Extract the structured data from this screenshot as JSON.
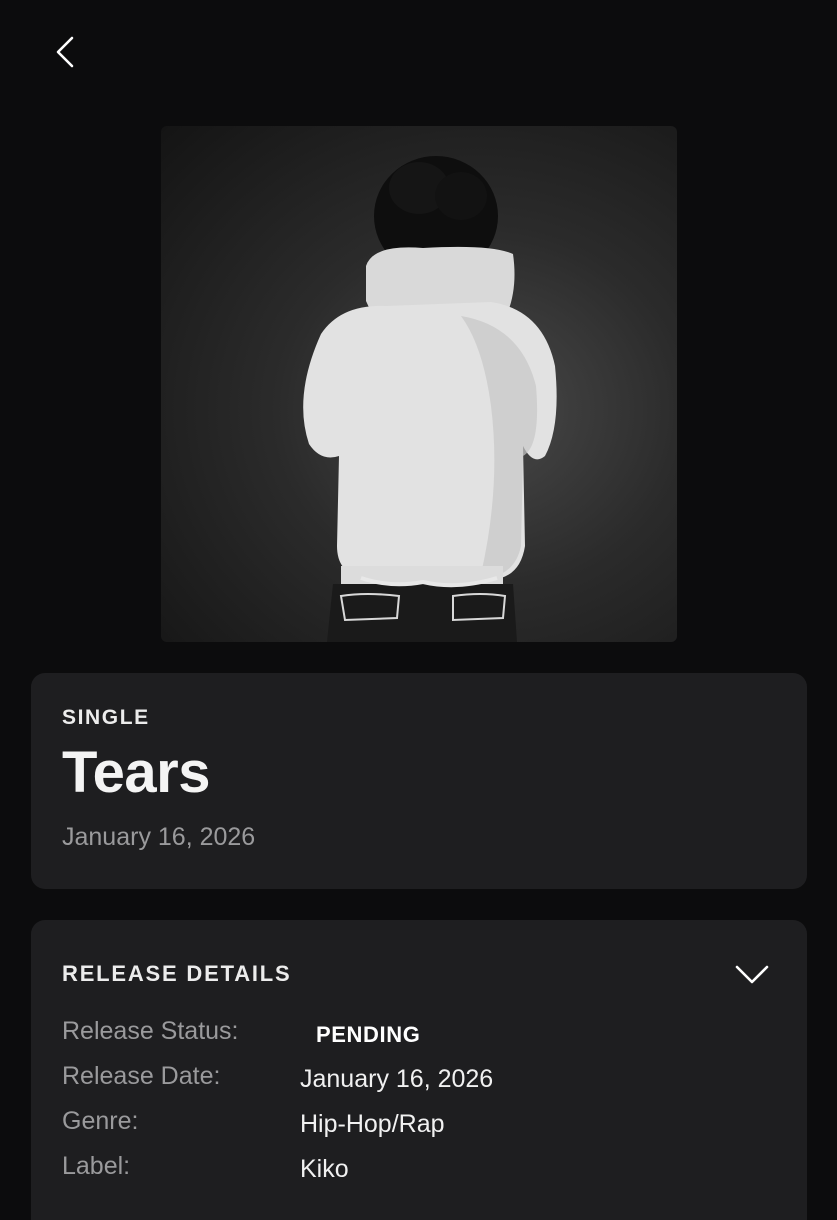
{
  "nav": {
    "back_icon": "chevron-left-icon"
  },
  "cover": {
    "alt": "Single artwork"
  },
  "release": {
    "type": "SINGLE",
    "title": "Tears",
    "date": "January 16, 2026"
  },
  "details": {
    "heading": "RELEASE DETAILS",
    "toggle_icon": "chevron-down-icon",
    "rows": [
      {
        "label": "Release Status:",
        "value": "PENDING"
      },
      {
        "label": "Release Date:",
        "value": "January 16, 2026"
      },
      {
        "label": "Genre:",
        "value": "Hip-Hop/Rap"
      },
      {
        "label": "Label:",
        "value": "Kiko"
      }
    ]
  },
  "colors": {
    "background": "#0c0c0d",
    "card": "#1e1e20",
    "muted_text": "#9a9a9c",
    "primary_text": "#ffffff"
  }
}
